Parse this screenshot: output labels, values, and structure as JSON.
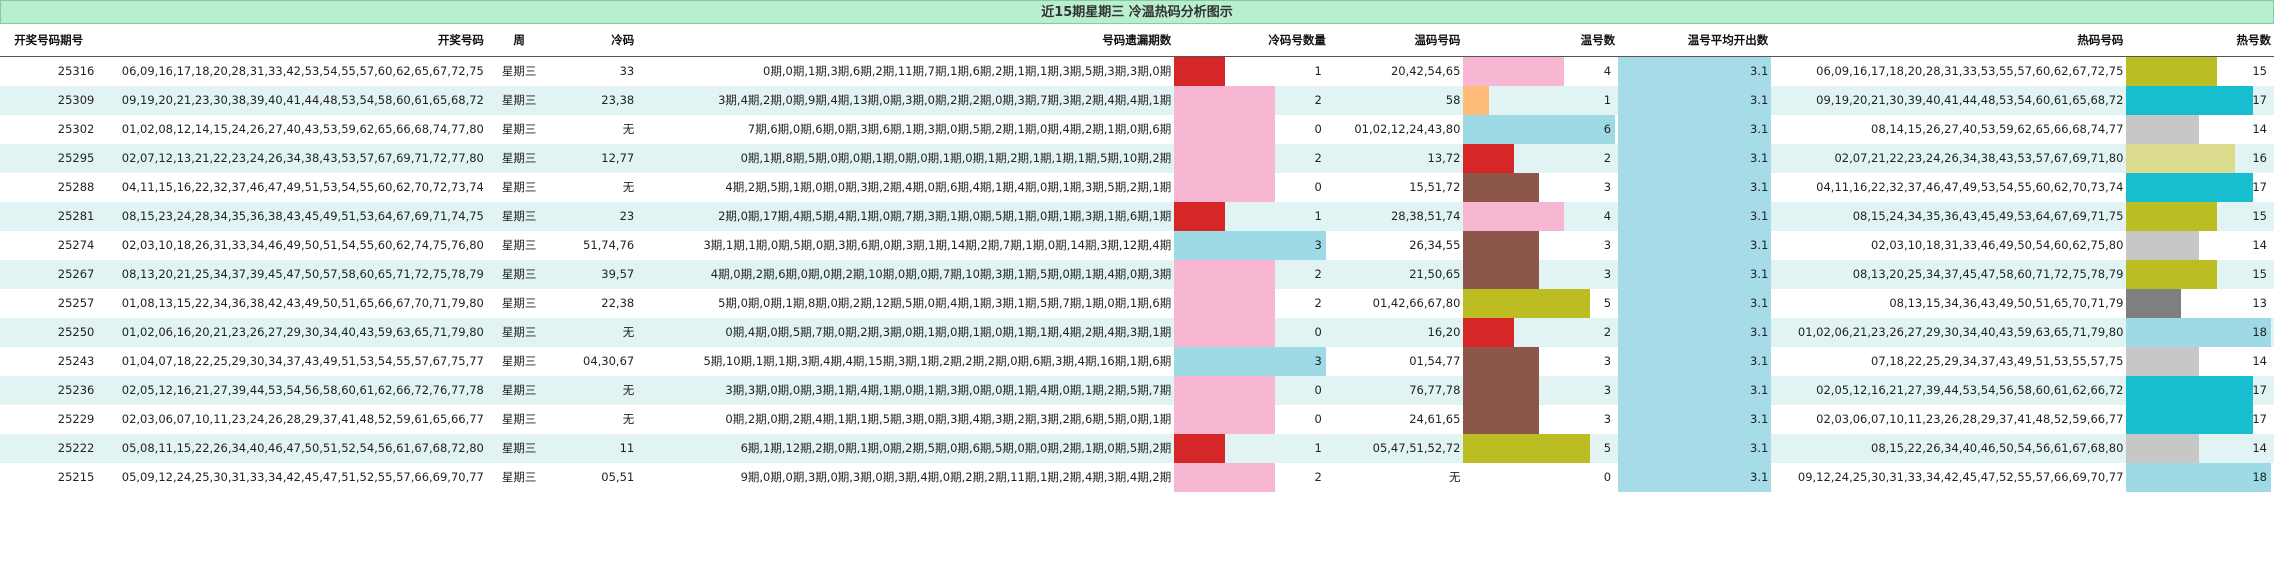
{
  "title": "近15期星期三 冷温热码分析图示",
  "headers": {
    "period": "开奖号码期号",
    "numbers": "开奖号码",
    "weekday": "周",
    "cold": "冷码",
    "omit": "号码遗漏期数",
    "cold_count": "冷码号数量",
    "warm": "温码号码",
    "warm_count": "温号数",
    "warm_avg": "温号平均开出数",
    "hot": "热码号码",
    "hot_count": "热号数"
  },
  "colors": {
    "red": "#d62728",
    "pink": "#f7b6d2",
    "lightblue": "#9edae5",
    "peach": "#ffbb78",
    "brown": "#8c564b",
    "olive": "#bcbd22",
    "cyan": "#17becf",
    "gray": "#c7c7c7",
    "darkgray": "#7f7f7f",
    "khaki": "#dbdb8d"
  },
  "rows": [
    {
      "period": "25316",
      "numbers": "06,09,16,17,18,20,28,31,33,42,53,54,55,57,60,62,65,67,72,75",
      "weekday": "星期三",
      "cold": "33",
      "omit": "0期,0期,1期,3期,6期,2期,11期,7期,1期,6期,2期,1期,1期,3期,5期,3期,3期,0期",
      "cold_count": 1,
      "cold_color": "red",
      "warm": "20,42,54,65",
      "warm_count": 4,
      "warm_color": "pink",
      "warm_avg": "3.1",
      "hot": "06,09,16,17,18,20,28,31,33,53,55,57,60,62,67,72,75",
      "hot_count": 15,
      "hot_color": "olive"
    },
    {
      "period": "25309",
      "numbers": "09,19,20,21,23,30,38,39,40,41,44,48,53,54,58,60,61,65,68,72",
      "weekday": "星期三",
      "cold": "23,38",
      "omit": "3期,4期,2期,0期,9期,4期,13期,0期,3期,0期,2期,2期,0期,3期,7期,3期,2期,4期,4期,1期",
      "cold_count": 2,
      "cold_color": "pink",
      "warm": "58",
      "warm_count": 1,
      "warm_color": "peach",
      "warm_avg": "3.1",
      "hot": "09,19,20,21,30,39,40,41,44,48,53,54,60,61,65,68,72",
      "hot_count": 17,
      "hot_color": "cyan"
    },
    {
      "period": "25302",
      "numbers": "01,02,08,12,14,15,24,26,27,40,43,53,59,62,65,66,68,74,77,80",
      "weekday": "星期三",
      "cold": "无",
      "omit": "7期,6期,0期,6期,0期,3期,6期,1期,3期,0期,5期,2期,1期,0期,4期,2期,1期,0期,6期",
      "cold_count": 0,
      "cold_color": "pink",
      "warm": "01,02,12,24,43,80",
      "warm_count": 6,
      "warm_color": "lightblue",
      "warm_avg": "3.1",
      "hot": "08,14,15,26,27,40,53,59,62,65,66,68,74,77",
      "hot_count": 14,
      "hot_color": "gray"
    },
    {
      "period": "25295",
      "numbers": "02,07,12,13,21,22,23,24,26,34,38,43,53,57,67,69,71,72,77,80",
      "weekday": "星期三",
      "cold": "12,77",
      "omit": "0期,1期,8期,5期,0期,0期,1期,0期,0期,1期,0期,1期,2期,1期,1期,1期,5期,10期,2期",
      "cold_count": 2,
      "cold_color": "pink",
      "warm": "13,72",
      "warm_count": 2,
      "warm_color": "red",
      "warm_avg": "3.1",
      "hot": "02,07,21,22,23,24,26,34,38,43,53,57,67,69,71,80",
      "hot_count": 16,
      "hot_color": "khaki"
    },
    {
      "period": "25288",
      "numbers": "04,11,15,16,22,32,37,46,47,49,51,53,54,55,60,62,70,72,73,74",
      "weekday": "星期三",
      "cold": "无",
      "omit": "4期,2期,5期,1期,0期,0期,3期,2期,4期,0期,6期,4期,1期,4期,0期,1期,3期,5期,2期,1期",
      "cold_count": 0,
      "cold_color": "pink",
      "warm": "15,51,72",
      "warm_count": 3,
      "warm_color": "brown",
      "warm_avg": "3.1",
      "hot": "04,11,16,22,32,37,46,47,49,53,54,55,60,62,70,73,74",
      "hot_count": 17,
      "hot_color": "cyan"
    },
    {
      "period": "25281",
      "numbers": "08,15,23,24,28,34,35,36,38,43,45,49,51,53,64,67,69,71,74,75",
      "weekday": "星期三",
      "cold": "23",
      "omit": "2期,0期,17期,4期,5期,4期,1期,0期,7期,3期,1期,0期,5期,1期,0期,1期,3期,1期,6期,1期",
      "cold_count": 1,
      "cold_color": "red",
      "warm": "28,38,51,74",
      "warm_count": 4,
      "warm_color": "pink",
      "warm_avg": "3.1",
      "hot": "08,15,24,34,35,36,43,45,49,53,64,67,69,71,75",
      "hot_count": 15,
      "hot_color": "olive"
    },
    {
      "period": "25274",
      "numbers": "02,03,10,18,26,31,33,34,46,49,50,51,54,55,60,62,74,75,76,80",
      "weekday": "星期三",
      "cold": "51,74,76",
      "omit": "3期,1期,1期,0期,5期,0期,3期,6期,0期,3期,1期,14期,2期,7期,1期,0期,14期,3期,12期,4期",
      "cold_count": 3,
      "cold_color": "lightblue",
      "warm": "26,34,55",
      "warm_count": 3,
      "warm_color": "brown",
      "warm_avg": "3.1",
      "hot": "02,03,10,18,31,33,46,49,50,54,60,62,75,80",
      "hot_count": 14,
      "hot_color": "gray"
    },
    {
      "period": "25267",
      "numbers": "08,13,20,21,25,34,37,39,45,47,50,57,58,60,65,71,72,75,78,79",
      "weekday": "星期三",
      "cold": "39,57",
      "omit": "4期,0期,2期,6期,0期,0期,2期,10期,0期,0期,7期,10期,3期,1期,5期,0期,1期,4期,0期,3期",
      "cold_count": 2,
      "cold_color": "pink",
      "warm": "21,50,65",
      "warm_count": 3,
      "warm_color": "brown",
      "warm_avg": "3.1",
      "hot": "08,13,20,25,34,37,45,47,58,60,71,72,75,78,79",
      "hot_count": 15,
      "hot_color": "olive"
    },
    {
      "period": "25257",
      "numbers": "01,08,13,15,22,34,36,38,42,43,49,50,51,65,66,67,70,71,79,80",
      "weekday": "星期三",
      "cold": "22,38",
      "omit": "5期,0期,0期,1期,8期,0期,2期,12期,5期,0期,4期,1期,3期,1期,5期,7期,1期,0期,1期,6期",
      "cold_count": 2,
      "cold_color": "pink",
      "warm": "01,42,66,67,80",
      "warm_count": 5,
      "warm_color": "olive",
      "warm_avg": "3.1",
      "hot": "08,13,15,34,36,43,49,50,51,65,70,71,79",
      "hot_count": 13,
      "hot_color": "darkgray"
    },
    {
      "period": "25250",
      "numbers": "01,02,06,16,20,21,23,26,27,29,30,34,40,43,59,63,65,71,79,80",
      "weekday": "星期三",
      "cold": "无",
      "omit": "0期,4期,0期,5期,7期,0期,2期,3期,0期,1期,0期,1期,0期,1期,1期,4期,2期,4期,3期,1期",
      "cold_count": 0,
      "cold_color": "pink",
      "warm": "16,20",
      "warm_count": 2,
      "warm_color": "red",
      "warm_avg": "3.1",
      "hot": "01,02,06,21,23,26,27,29,30,34,40,43,59,63,65,71,79,80",
      "hot_count": 18,
      "hot_color": "lightblue"
    },
    {
      "period": "25243",
      "numbers": "01,04,07,18,22,25,29,30,34,37,43,49,51,53,54,55,57,67,75,77",
      "weekday": "星期三",
      "cold": "04,30,67",
      "omit": "5期,10期,1期,1期,3期,4期,4期,15期,3期,1期,2期,2期,2期,0期,6期,3期,4期,16期,1期,6期",
      "cold_count": 3,
      "cold_color": "lightblue",
      "warm": "01,54,77",
      "warm_count": 3,
      "warm_color": "brown",
      "warm_avg": "3.1",
      "hot": "07,18,22,25,29,34,37,43,49,51,53,55,57,75",
      "hot_count": 14,
      "hot_color": "gray"
    },
    {
      "period": "25236",
      "numbers": "02,05,12,16,21,27,39,44,53,54,56,58,60,61,62,66,72,76,77,78",
      "weekday": "星期三",
      "cold": "无",
      "omit": "3期,3期,0期,0期,3期,1期,4期,1期,0期,1期,3期,0期,0期,1期,4期,0期,1期,2期,5期,7期",
      "cold_count": 0,
      "cold_color": "pink",
      "warm": "76,77,78",
      "warm_count": 3,
      "warm_color": "brown",
      "warm_avg": "3.1",
      "hot": "02,05,12,16,21,27,39,44,53,54,56,58,60,61,62,66,72",
      "hot_count": 17,
      "hot_color": "cyan"
    },
    {
      "period": "25229",
      "numbers": "02,03,06,07,10,11,23,24,26,28,29,37,41,48,52,59,61,65,66,77",
      "weekday": "星期三",
      "cold": "无",
      "omit": "0期,2期,0期,2期,4期,1期,1期,5期,3期,0期,3期,4期,3期,2期,3期,2期,6期,5期,0期,1期",
      "cold_count": 0,
      "cold_color": "pink",
      "warm": "24,61,65",
      "warm_count": 3,
      "warm_color": "brown",
      "warm_avg": "3.1",
      "hot": "02,03,06,07,10,11,23,26,28,29,37,41,48,52,59,66,77",
      "hot_count": 17,
      "hot_color": "cyan"
    },
    {
      "period": "25222",
      "numbers": "05,08,11,15,22,26,34,40,46,47,50,51,52,54,56,61,67,68,72,80",
      "weekday": "星期三",
      "cold": "11",
      "omit": "6期,1期,12期,2期,0期,1期,0期,2期,5期,0期,6期,5期,0期,0期,2期,1期,0期,5期,2期",
      "cold_count": 1,
      "cold_color": "red",
      "warm": "05,47,51,52,72",
      "warm_count": 5,
      "warm_color": "olive",
      "warm_avg": "3.1",
      "hot": "08,15,22,26,34,40,46,50,54,56,61,67,68,80",
      "hot_count": 14,
      "hot_color": "gray"
    },
    {
      "period": "25215",
      "numbers": "05,09,12,24,25,30,31,33,34,42,45,47,51,52,55,57,66,69,70,77",
      "weekday": "星期三",
      "cold": "05,51",
      "omit": "9期,0期,0期,3期,0期,3期,0期,3期,4期,0期,2期,2期,11期,1期,2期,4期,3期,4期,2期",
      "cold_count": 2,
      "cold_color": "pink",
      "warm": "无",
      "warm_count": 0,
      "warm_color": "pink",
      "warm_avg": "3.1",
      "hot": "09,12,24,25,30,31,33,34,42,45,47,52,55,57,66,69,70,77",
      "hot_count": 18,
      "hot_color": "lightblue"
    }
  ]
}
